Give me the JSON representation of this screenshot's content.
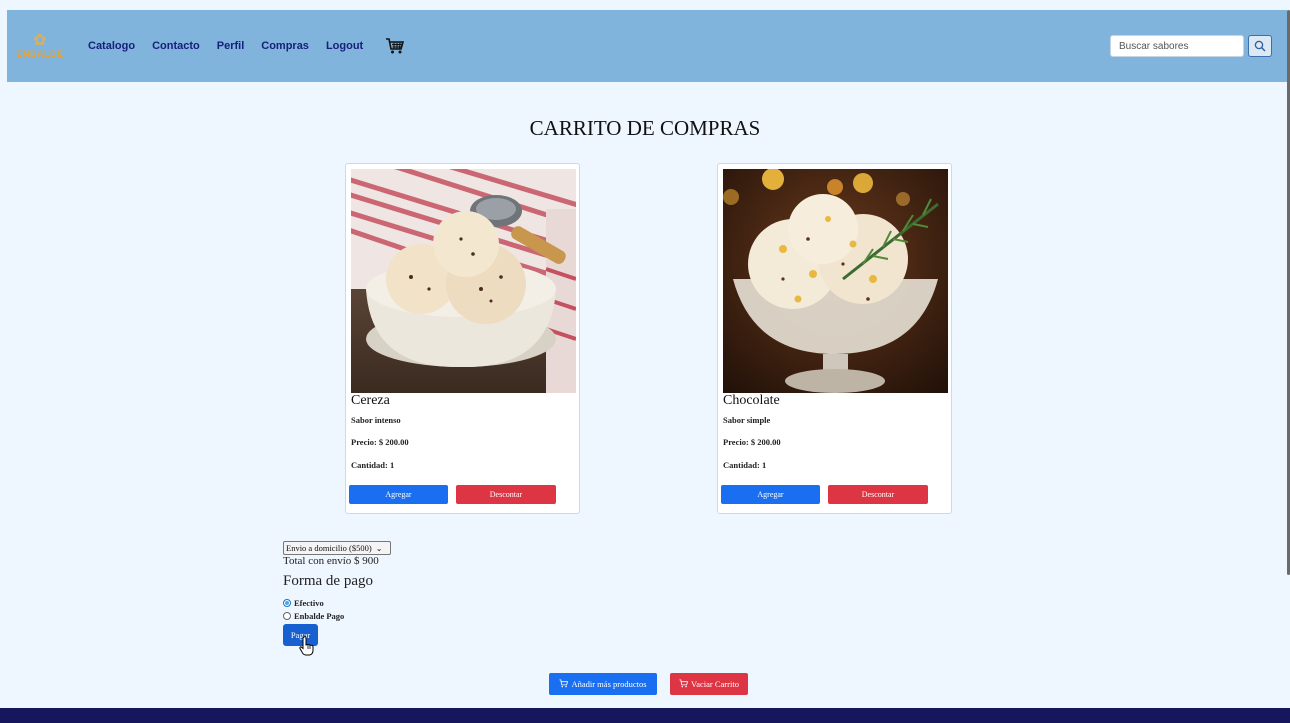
{
  "navbar": {
    "logo_text": "ENBALDE",
    "links": [
      "Catalogo",
      "Contacto",
      "Perfil",
      "Compras",
      "Logout"
    ],
    "search_placeholder": "Buscar sabores"
  },
  "page_title": "CARRITO DE COMPRAS",
  "products": [
    {
      "name": "Cereza",
      "description": "Sabor intenso",
      "price": "Precio: $ 200.00",
      "quantity": "Cantidad: 1",
      "add_label": "Agregar",
      "remove_label": "Descontar"
    },
    {
      "name": "Chocolate",
      "description": "Sabor simple",
      "price": "Precio: $ 200.00",
      "quantity": "Cantidad: 1",
      "add_label": "Agregar",
      "remove_label": "Descontar"
    }
  ],
  "shipping": {
    "selected": "Envio a domicilio ($500)",
    "total": "Total con envío $ 900"
  },
  "payment": {
    "heading": "Forma de pago",
    "options": [
      {
        "label": "Efectivo",
        "checked": true
      },
      {
        "label": "Enbalde Pago",
        "checked": false
      }
    ],
    "pay_label": "Pagar"
  },
  "actions": {
    "add_more_label": "Añadir más productos",
    "empty_cart_label": "Vaciar Carrito"
  },
  "colors": {
    "navbar": "#80b4dc",
    "background": "#eef6ff",
    "primary": "#1a6ef0",
    "danger": "#dd3544",
    "footer": "#16165c",
    "nav_link": "#17207a"
  }
}
